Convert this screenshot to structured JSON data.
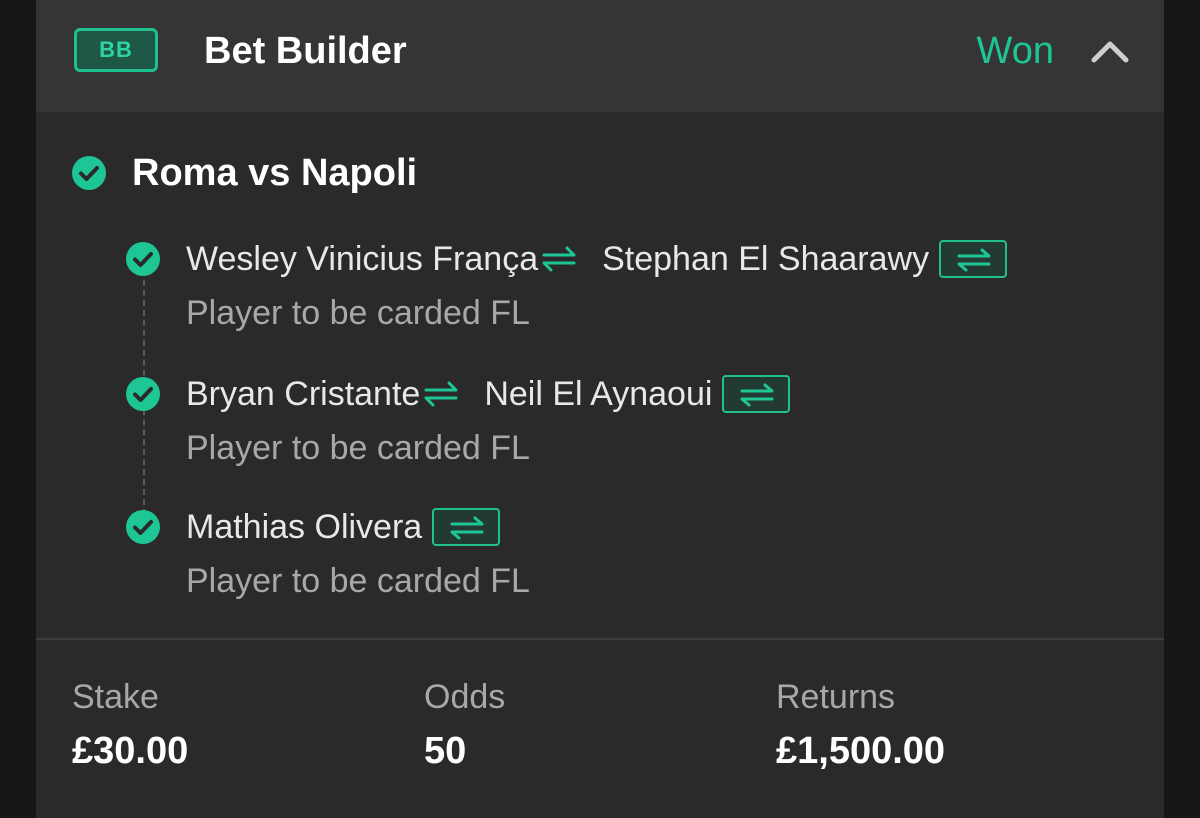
{
  "header": {
    "badge": "BB",
    "title": "Bet Builder",
    "status": "Won",
    "collapse_icon": "chevron-up-icon",
    "accent_color": "#1fc695"
  },
  "match": {
    "title": "Roma vs Napoli",
    "status_icon": "check-circle-icon"
  },
  "legs": [
    {
      "player": "Wesley Vinicius França",
      "substitute": "Stephan El Shaarawy",
      "market": "Player to be carded FL"
    },
    {
      "player": "Bryan Cristante",
      "substitute": "Neil El Aynaoui",
      "market": "Player to be carded FL"
    },
    {
      "player": "Mathias Olivera",
      "market": "Player to be carded FL"
    }
  ],
  "summary": {
    "stake_label": "Stake",
    "stake_value": "£30.00",
    "odds_label": "Odds",
    "odds_value": "50",
    "returns_label": "Returns",
    "returns_value": "£1,500.00"
  }
}
